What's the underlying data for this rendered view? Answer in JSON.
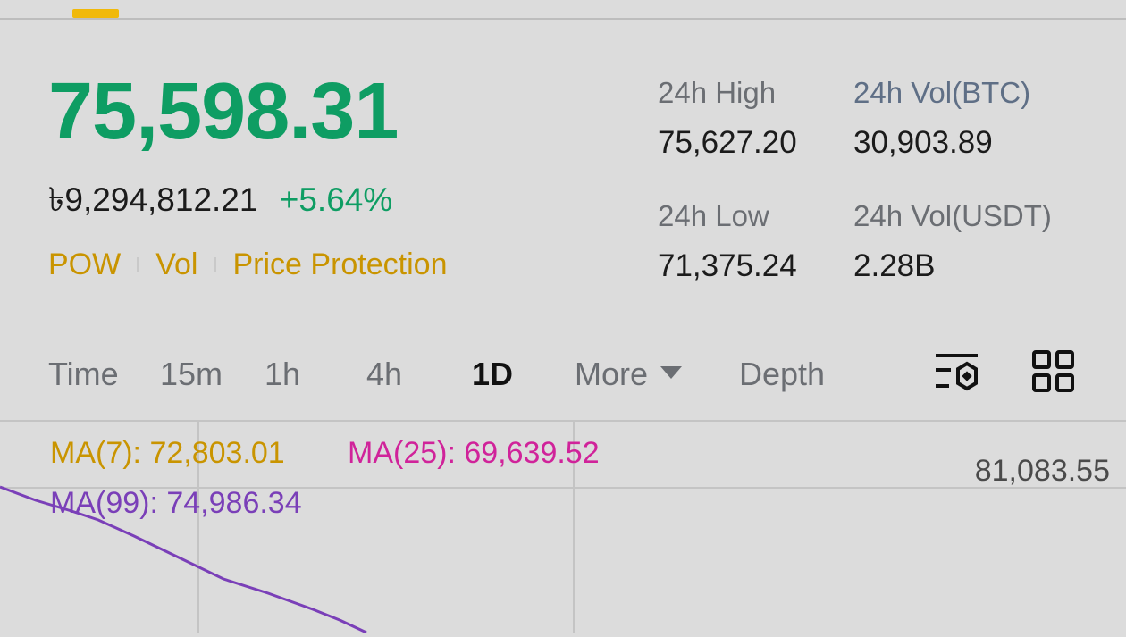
{
  "header": {
    "last_price": "75,598.31",
    "fiat_price": "৳9,294,812.21",
    "change_pct": "+5.64%",
    "tags": [
      "POW",
      "Vol",
      "Price Protection"
    ]
  },
  "stats": {
    "high_label": "24h High",
    "high_value": "75,627.20",
    "low_label": "24h Low",
    "low_value": "71,375.24",
    "vol_btc_label": "24h Vol(BTC)",
    "vol_btc_value": "30,903.89",
    "vol_usdt_label": "24h Vol(USDT)",
    "vol_usdt_value": "2.28B"
  },
  "interval_tabs": {
    "items": [
      "Time",
      "15m",
      "1h",
      "4h",
      "1D",
      "More",
      "Depth"
    ],
    "active": "1D"
  },
  "icons": {
    "indicator_settings": "chart-settings-icon",
    "layout": "grid-layout-icon"
  },
  "chart": {
    "ma7": "MA(7): 72,803.01",
    "ma25": "MA(25): 69,639.52",
    "ma99": "MA(99): 74,986.34",
    "price_scale_top": "81,083.55"
  },
  "colors": {
    "up": "#0e9d63",
    "accent": "#f0b90b",
    "tag": "#c99400",
    "ma7": "#c99400",
    "ma25": "#d0239a",
    "ma99": "#7a3fb8"
  }
}
